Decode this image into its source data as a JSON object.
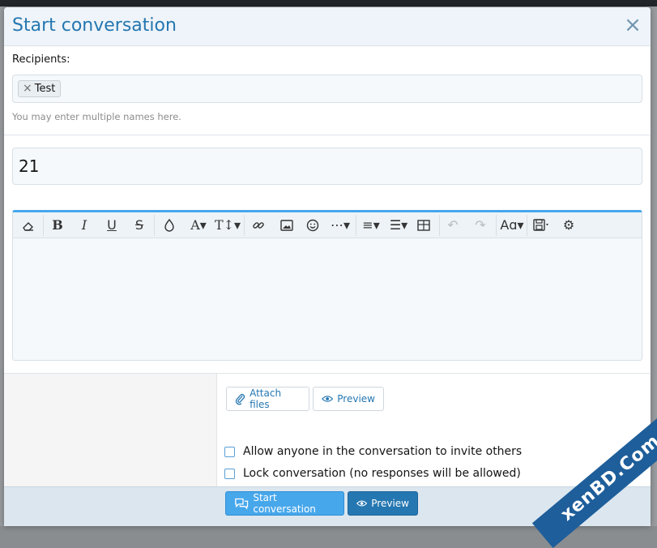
{
  "dialog": {
    "title": "Start conversation",
    "close_icon": "close-icon",
    "close_glyph": "×"
  },
  "recipients": {
    "label": "Recipients:",
    "tags": [
      {
        "name": "Test",
        "remove_glyph": "×"
      }
    ],
    "hint": "You may enter multiple names here."
  },
  "title_input": {
    "value": "21"
  },
  "editor": {
    "accent_color": "#47a7eb",
    "toolbar": [
      {
        "name": "clear-format-button",
        "icon": "eraser-icon",
        "glyph": "⌫",
        "enabled": true
      },
      {
        "name": "bold-button",
        "icon": "bold-icon",
        "glyph": "B",
        "enabled": true
      },
      {
        "name": "italic-button",
        "icon": "italic-icon",
        "glyph": "I",
        "enabled": true
      },
      {
        "name": "underline-button",
        "icon": "underline-icon",
        "glyph": "U",
        "enabled": true
      },
      {
        "name": "strikethrough-button",
        "icon": "strikethrough-icon",
        "glyph": "S",
        "enabled": true
      },
      {
        "name": "text-color-button",
        "icon": "droplet-icon",
        "glyph": "💧",
        "enabled": true
      },
      {
        "name": "font-family-button",
        "icon": "font-family-icon",
        "glyph": "A▾",
        "enabled": true
      },
      {
        "name": "font-size-button",
        "icon": "font-size-icon",
        "glyph": "T↕▾",
        "enabled": true
      },
      {
        "name": "link-button",
        "icon": "link-icon",
        "glyph": "🔗",
        "enabled": true
      },
      {
        "name": "image-button",
        "icon": "image-icon",
        "glyph": "🖼",
        "enabled": true
      },
      {
        "name": "smilie-button",
        "icon": "smile-icon",
        "glyph": "☺",
        "enabled": true
      },
      {
        "name": "more-button",
        "icon": "ellipsis-icon",
        "glyph": "⋯▾",
        "enabled": true
      },
      {
        "name": "align-button",
        "icon": "align-left-icon",
        "glyph": "≡▾",
        "enabled": true
      },
      {
        "name": "list-button",
        "icon": "list-icon",
        "glyph": "☰▾",
        "enabled": true
      },
      {
        "name": "table-button",
        "icon": "table-icon",
        "glyph": "⊞",
        "enabled": true
      },
      {
        "name": "undo-button",
        "icon": "undo-icon",
        "glyph": "↶",
        "enabled": false
      },
      {
        "name": "redo-button",
        "icon": "redo-icon",
        "glyph": "↷",
        "enabled": false
      },
      {
        "name": "spell-button",
        "icon": "spellcheck-icon",
        "glyph": "Aɑ▾",
        "enabled": true
      },
      {
        "name": "drafts-button",
        "icon": "save-icon",
        "glyph": "🖫▾",
        "enabled": true
      },
      {
        "name": "options-button",
        "icon": "gear-icon",
        "glyph": "⚙",
        "enabled": true
      }
    ]
  },
  "attachments": {
    "attach_label": "Attach files",
    "attach_icon": "paperclip-icon",
    "preview_label": "Preview",
    "preview_icon": "eye-icon"
  },
  "options": [
    {
      "label": "Allow anyone in the conversation to invite others",
      "checked": false
    },
    {
      "label": "Lock conversation (no responses will be allowed)",
      "checked": false
    }
  ],
  "actions": {
    "start_label": "Start conversation",
    "start_icon": "comments-icon",
    "preview_label": "Preview",
    "preview_icon": "eye-icon"
  },
  "watermark": {
    "text": "xenBD.Com"
  }
}
